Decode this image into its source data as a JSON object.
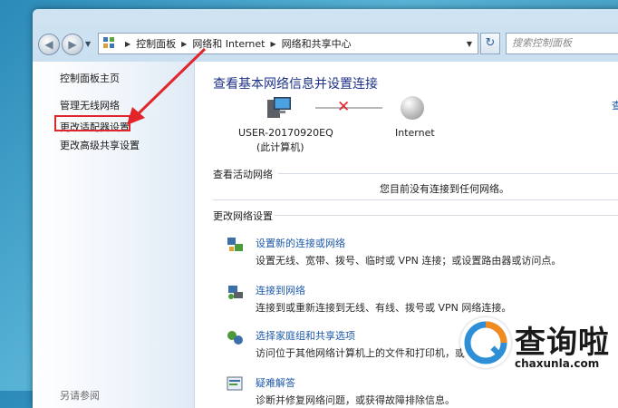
{
  "address": {
    "crumbs": [
      "控制面板",
      "网络和 Internet",
      "网络和共享中心"
    ],
    "search_placeholder": "搜索控制面板"
  },
  "sidebar": {
    "items": [
      {
        "label": "控制面板主页"
      },
      {
        "label": "管理无线网络"
      },
      {
        "label": "更改适配器设置"
      },
      {
        "label": "更改高级共享设置"
      }
    ],
    "see_also": "另请参阅"
  },
  "main": {
    "title": "查看基本网络信息并设置连接",
    "more": "查",
    "computer_name": "USER-20170920EQ",
    "computer_sub": "(此计算机)",
    "internet_label": "Internet",
    "active_header": "查看活动网络",
    "no_connection": "您目前没有连接到任何网络。",
    "change_header": "更改网络设置",
    "tasks": [
      {
        "link": "设置新的连接或网络",
        "desc": "设置无线、宽带、拨号、临时或 VPN 连接；或设置路由器或访问点。"
      },
      {
        "link": "连接到网络",
        "desc": "连接到或重新连接到无线、有线、拨号或 VPN 网络连接。"
      },
      {
        "link": "选择家庭组和共享选项",
        "desc": "访问位于其他网络计算机上的文件和打印机，或"
      },
      {
        "link": "疑难解答",
        "desc": "诊断并修复网络问题，或获得故障排除信息。"
      }
    ]
  },
  "watermark": {
    "brand": "查询啦",
    "url": "chaxunla.com"
  },
  "colors": {
    "annotation": "#e0262b",
    "link": "#1e5aa8",
    "title": "#1e3287"
  }
}
